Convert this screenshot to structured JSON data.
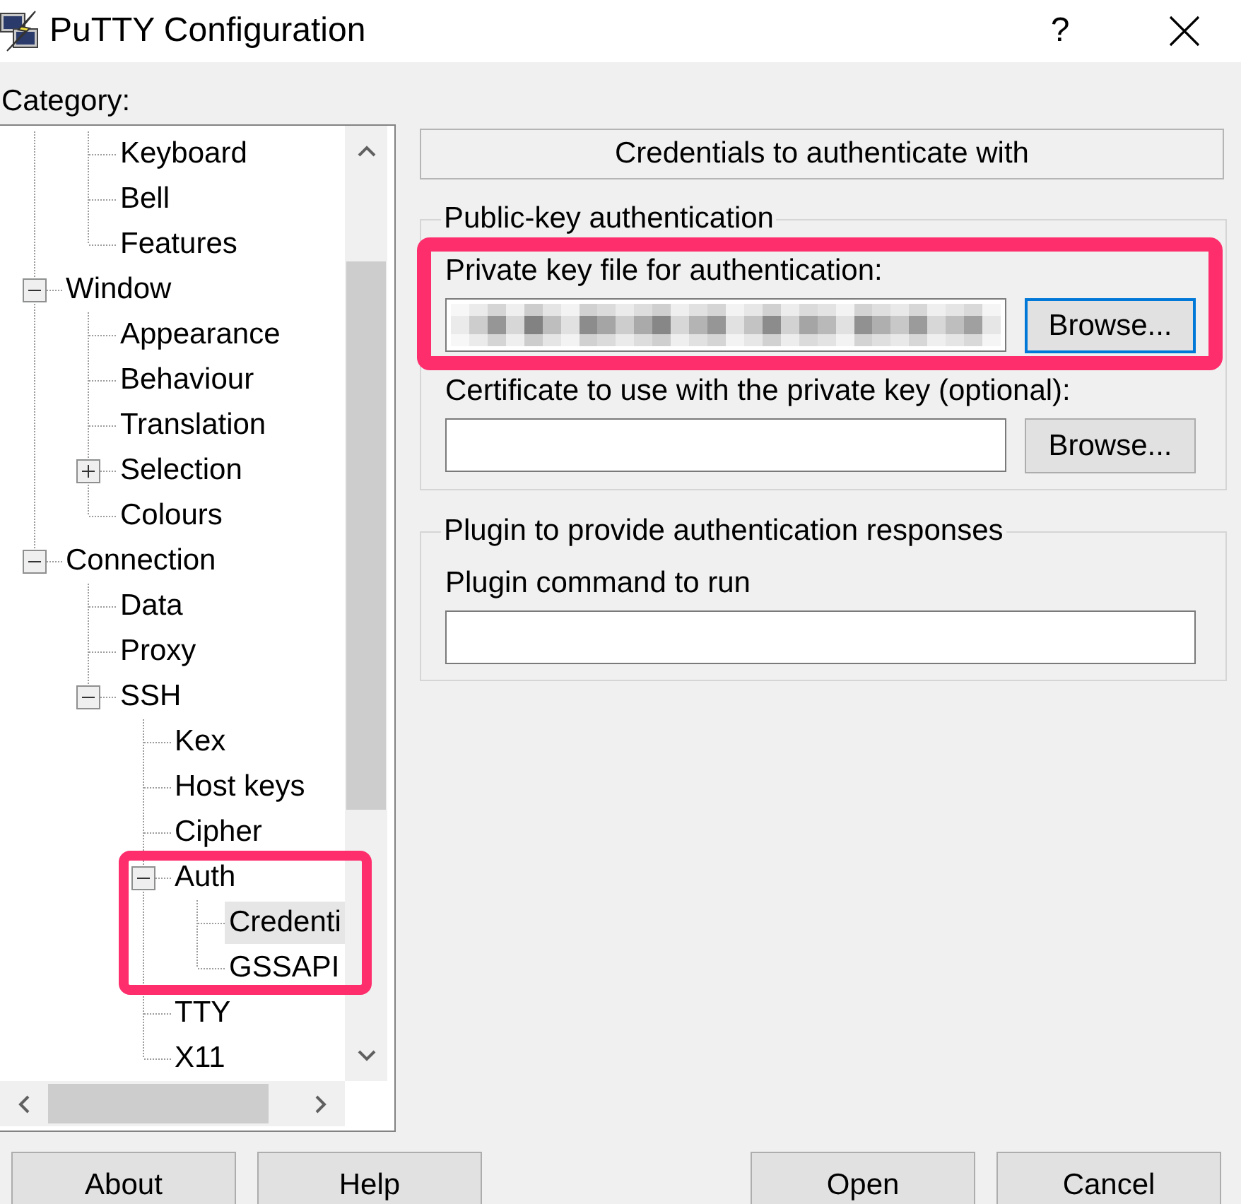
{
  "window": {
    "title": "PuTTY Configuration",
    "help_button": "?"
  },
  "category_label": "Category:",
  "tree": {
    "items": [
      {
        "children": [
          {
            "label": "Keyboard",
            "selected": false,
            "highlighted": false
          },
          {
            "label": "Bell",
            "selected": false,
            "highlighted": false
          },
          {
            "label": "Features",
            "selected": false,
            "highlighted": false
          }
        ]
      },
      {
        "label": "Window",
        "expanded": true,
        "selected": false,
        "highlighted": false,
        "children": [
          {
            "label": "Appearance",
            "selected": false,
            "highlighted": false
          },
          {
            "label": "Behaviour",
            "selected": false,
            "highlighted": false
          },
          {
            "label": "Translation",
            "selected": false,
            "highlighted": false
          },
          {
            "label": "Selection",
            "expanded": false,
            "selected": false,
            "highlighted": false
          },
          {
            "label": "Colours",
            "selected": false,
            "highlighted": false
          }
        ]
      },
      {
        "label": "Connection",
        "expanded": true,
        "selected": false,
        "highlighted": false,
        "children": [
          {
            "label": "Data",
            "selected": false,
            "highlighted": false
          },
          {
            "label": "Proxy",
            "selected": false,
            "highlighted": false
          },
          {
            "label": "SSH",
            "expanded": true,
            "selected": false,
            "highlighted": false,
            "children": [
              {
                "label": "Kex",
                "selected": false,
                "highlighted": false
              },
              {
                "label": "Host keys",
                "selected": false,
                "highlighted": false
              },
              {
                "label": "Cipher",
                "selected": false,
                "highlighted": false
              },
              {
                "label": "Auth",
                "expanded": true,
                "selected": false,
                "highlighted": true,
                "children": [
                  {
                    "label": "Credenti",
                    "selected": true,
                    "highlighted": false
                  },
                  {
                    "label": "GSSAPI",
                    "selected": false,
                    "highlighted": false
                  }
                ]
              },
              {
                "label": "TTY",
                "selected": false,
                "highlighted": false
              },
              {
                "label": "X11",
                "selected": false,
                "highlighted": false
              }
            ]
          }
        ]
      }
    ]
  },
  "panel": {
    "header": "Credentials to authenticate with",
    "groups": [
      {
        "title": "Public-key authentication",
        "fields": [
          {
            "label": "Private key file for authentication:",
            "value_redacted": true,
            "highlighted": true,
            "button": {
              "label": "Browse...",
              "focused": true
            }
          },
          {
            "label": "Certificate to use with the private key (optional):",
            "value_redacted": false,
            "highlighted": false,
            "button": {
              "label": "Browse...",
              "focused": false
            }
          }
        ]
      },
      {
        "title": "Plugin to provide authentication responses",
        "fields": [
          {
            "label": "Plugin command to run",
            "value_redacted": false,
            "highlighted": false
          }
        ]
      }
    ]
  },
  "buttons_left": [
    "About",
    "Help"
  ],
  "buttons_right": [
    "Open",
    "Cancel"
  ]
}
